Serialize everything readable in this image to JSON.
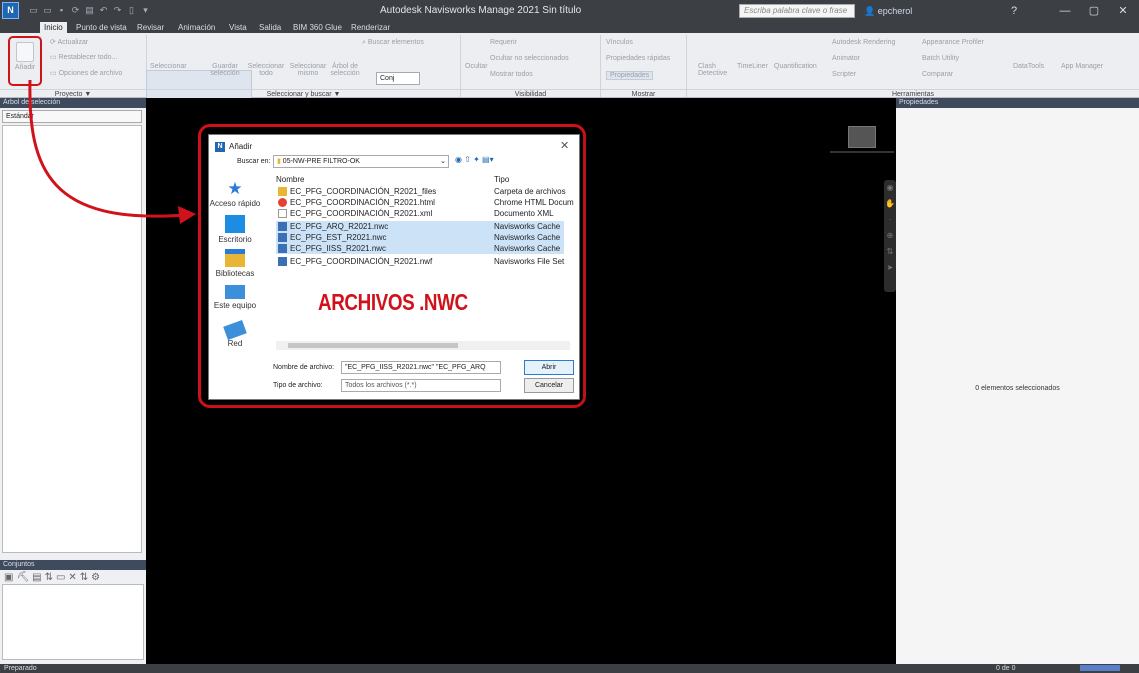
{
  "app": {
    "title": "Autodesk Navisworks Manage 2021   Sin título",
    "app_logo": "N",
    "search_placeholder": "Escriba palabra clave o frase",
    "user": "epcherol",
    "minimize": "—",
    "maximize": "▢",
    "close": "✕",
    "help": "?"
  },
  "tabs": [
    "Inicio",
    "Punto de vista",
    "Revisar",
    "Animación",
    "Vista",
    "Salida",
    "BIM 360 Glue",
    "Renderizar"
  ],
  "ribbon": {
    "proyecto": {
      "anadir": "Añadir",
      "actualizar": "Actualizar",
      "restablecer": "Restablecer todo...",
      "opciones": "Opciones de archivo",
      "panel": "Proyecto ▼"
    },
    "seleccionar": {
      "seleccionar": "Seleccionar",
      "guardar": "Guardar selección",
      "seleccionar_todo": "Seleccionar todo",
      "seleccionar_mismo": "Seleccionar mismo",
      "arbol": "Árbol de selección",
      "buscar": "Buscar elementos",
      "conj": "Conj",
      "panel": "Seleccionar y buscar ▼"
    },
    "visibilidad": {
      "ocultar": "Ocultar",
      "requerir": "Requerir",
      "ocultar_no_sel": "Ocultar no seleccionados",
      "mostrar_todos": "Mostrar todos",
      "panel": "Visibilidad"
    },
    "mostrar": {
      "vinculos": "Vínculos",
      "prop_rapidas": "Propiedades rápidas",
      "propiedades": "Propiedades",
      "panel": "Mostrar"
    },
    "herramientas": {
      "clash": "Clash Detective",
      "timeliner": "TimeLiner",
      "quantification": "Quantification",
      "autodesk_rendering": "Autodesk Rendering",
      "animator": "Animator",
      "scripter": "Scripter",
      "appearance": "Appearance Profiler",
      "batch": "Batch Utility",
      "comparar": "Comparar",
      "datatools": "DataTools",
      "appmanager": "App Manager",
      "panel": "Herramientas"
    }
  },
  "left_pane": {
    "title": "Árbol de selección",
    "dropdown": "Estándar",
    "sets_title": "Conjuntos"
  },
  "right_pane": {
    "title": "Propiedades",
    "empty_text": "0 elementos seleccionados"
  },
  "status": {
    "text": "Preparado",
    "page": "0 de 0"
  },
  "dialog": {
    "title": "Añadir",
    "close": "✕",
    "lookin_label": "Buscar en:",
    "lookin_value": "05-NW-PRE FILTRO-OK",
    "col_name": "Nombre",
    "col_type": "Tipo",
    "places": [
      "Acceso rápido",
      "Escritorio",
      "Bibliotecas",
      "Este equipo",
      "Red"
    ],
    "files": [
      {
        "name": "EC_PFG_COORDINACIÓN_R2021_files",
        "type": "Carpeta de archivos",
        "icon": "folder-icon",
        "selected": false
      },
      {
        "name": "EC_PFG_COORDINACIÓN_R2021.html",
        "type": "Chrome HTML Docum",
        "icon": "chrome-icon",
        "selected": false
      },
      {
        "name": "EC_PFG_COORDINACIÓN_R2021.xml",
        "type": "Documento XML",
        "icon": "xml-file-icon",
        "selected": false
      },
      {
        "name": "EC_PFG_ARQ_R2021.nwc",
        "type": "Navisworks Cache",
        "icon": "nwc-file-icon",
        "selected": true
      },
      {
        "name": "EC_PFG_EST_R2021.nwc",
        "type": "Navisworks Cache",
        "icon": "nwc-file-icon",
        "selected": true
      },
      {
        "name": "EC_PFG_IISS_R2021.nwc",
        "type": "Navisworks Cache",
        "icon": "nwc-file-icon",
        "selected": true
      },
      {
        "name": "EC_PFG_COORDINACIÓN_R2021.nwf",
        "type": "Navisworks File Set",
        "icon": "nwf-file-icon",
        "selected": false
      }
    ],
    "filename_label": "Nombre de archivo:",
    "filename_value": "\"EC_PFG_IISS_R2021.nwc\" \"EC_PFG_ARQ",
    "filetype_label": "Tipo de archivo:",
    "filetype_value": "Todos los archivos (*.*)",
    "open": "Abrir",
    "cancel": "Cancelar"
  },
  "annotation": {
    "text": "ARCHIVOS .NWC",
    "color": "#d0121b"
  }
}
